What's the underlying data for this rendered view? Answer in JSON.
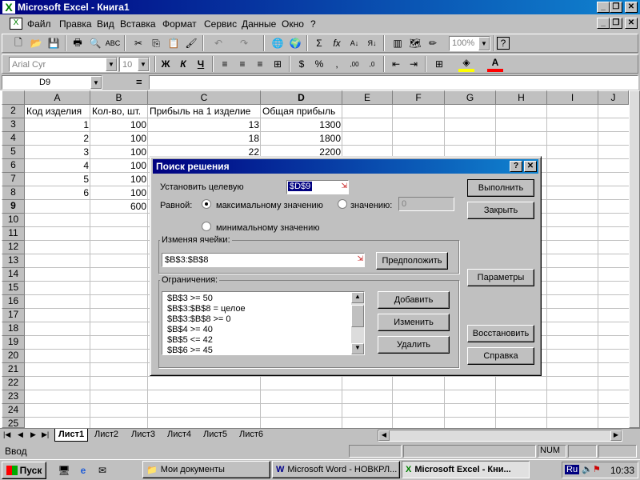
{
  "app": {
    "title": "Microsoft Excel - Книга1"
  },
  "menu": [
    "Файл",
    "Правка",
    "Вид",
    "Вставка",
    "Формат",
    "Сервис",
    "Данные",
    "Окно",
    "?"
  ],
  "toolbar": {
    "zoom": "100%",
    "font_name": "Arial Cyr",
    "font_size": "10",
    "bold": "Ж",
    "italic": "К",
    "underline": "Ч"
  },
  "formula_bar": {
    "name_box": "D9",
    "equals": "="
  },
  "sheet": {
    "columns": [
      "A",
      "B",
      "C",
      "D",
      "E",
      "F",
      "G",
      "H",
      "I",
      "J"
    ],
    "rows": [
      "2",
      "3",
      "4",
      "5",
      "6",
      "7",
      "8",
      "9",
      "10",
      "11",
      "12",
      "13",
      "14",
      "15",
      "16",
      "17",
      "18",
      "19",
      "20",
      "21",
      "22",
      "23",
      "24",
      "25"
    ],
    "header": [
      "Код изделия",
      "Кол-во, шт.",
      "Прибыль на 1 изделие",
      "Общая прибыль"
    ],
    "data": [
      [
        "1",
        "100",
        "13",
        "1300"
      ],
      [
        "2",
        "100",
        "18",
        "1800"
      ],
      [
        "3",
        "100",
        "22",
        "2200"
      ],
      [
        "4",
        "100"
      ],
      [
        "5",
        "100"
      ],
      [
        "6",
        "100"
      ]
    ],
    "total_b9": "600",
    "tabs": [
      "Лист1",
      "Лист2",
      "Лист3",
      "Лист4",
      "Лист5",
      "Лист6"
    ]
  },
  "dialog": {
    "title": "Поиск решения",
    "set_target_label": "Установить целевую",
    "target_cell": "$D$9",
    "equal_label": "Равной:",
    "max_label": "максимальному значению",
    "value_label": "значению:",
    "value_field": "0",
    "min_label": "минимальному значению",
    "changing_label": "Изменяя ячейки:",
    "changing_cells": "$B$3:$B$8",
    "guess_button": "Предположить",
    "constraints_label": "Ограничения:",
    "constraints": [
      "$B$3 >= 50",
      "$B$3:$B$8 = целое",
      "$B$3:$B$8 >= 0",
      "$B$4 >= 40",
      "$B$5 <= 42",
      "$B$6 >= 45"
    ],
    "add_button": "Добавить",
    "change_button": "Изменить",
    "delete_button": "Удалить",
    "solve_button": "Выполнить",
    "close_button": "Закрыть",
    "options_button": "Параметры",
    "reset_button": "Восстановить",
    "help_button": "Справка"
  },
  "status": {
    "mode": "Ввод",
    "num": "NUM"
  },
  "taskbar": {
    "start": "Пуск",
    "items": [
      "Мои документы",
      "Microsoft Word - НОВКРЛ...",
      "Microsoft Excel - Кни..."
    ],
    "lang": "Ru",
    "clock": "10:33"
  },
  "colors": {
    "title_active": "#000080",
    "face": "#c0c0c0",
    "selection": "#000080"
  }
}
